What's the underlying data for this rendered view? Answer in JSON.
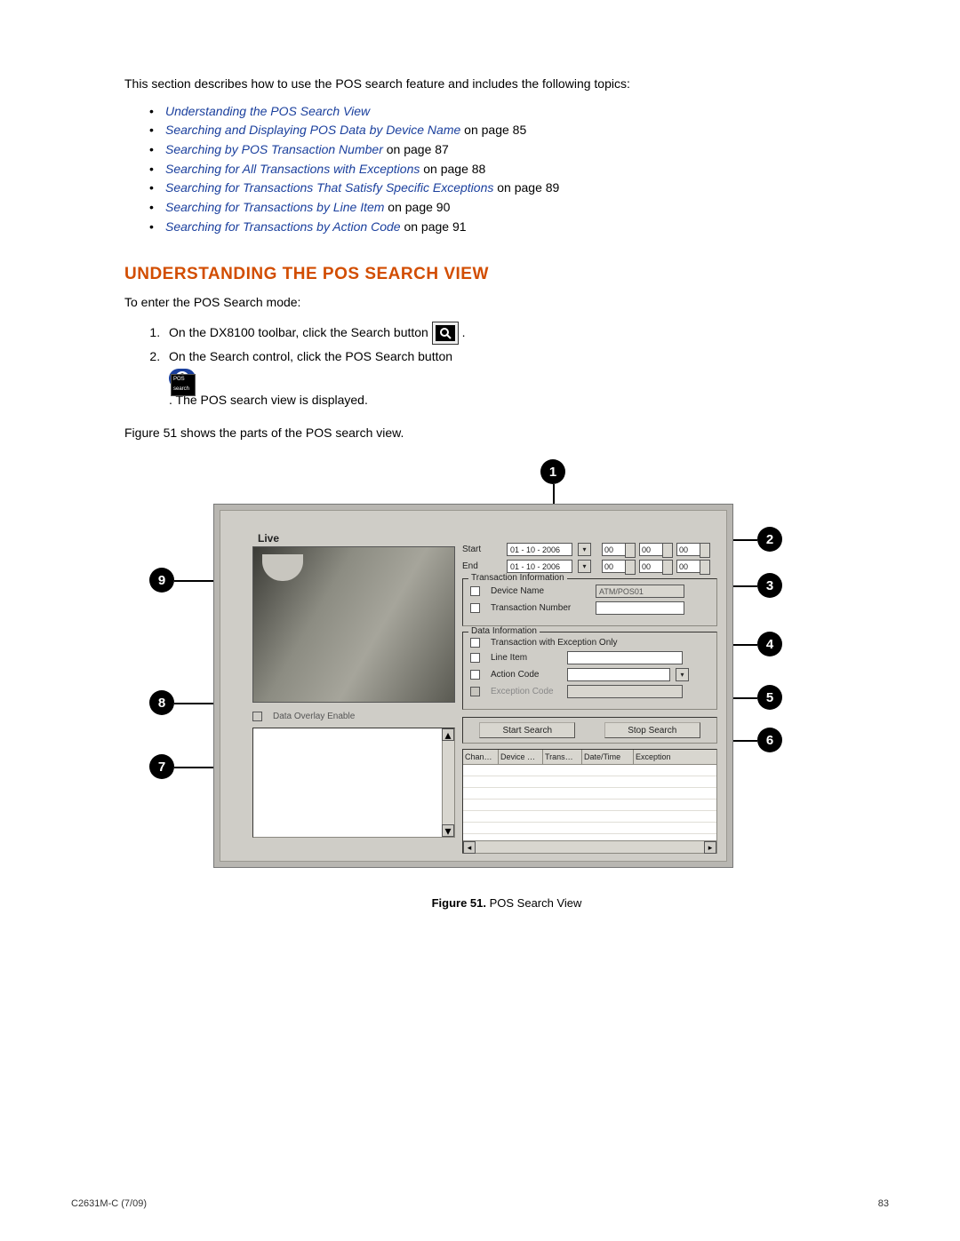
{
  "intro": "This section describes how to use the POS search feature and includes the following topics:",
  "bullets": [
    {
      "link": "Understanding the POS Search View",
      "suffix": ""
    },
    {
      "link": "Searching and Displaying POS Data by Device Name",
      "suffix": " on page 85"
    },
    {
      "link": "Searching by POS Transaction Number",
      "suffix": " on page 87"
    },
    {
      "link": "Searching for All Transactions with Exceptions",
      "suffix": " on page 88"
    },
    {
      "link": "Searching for Transactions That Satisfy Specific Exceptions",
      "suffix": " on page 89"
    },
    {
      "link": "Searching for Transactions by Line Item",
      "suffix": " on page 90"
    },
    {
      "link": "Searching for Transactions by Action Code",
      "suffix": " on page 91"
    }
  ],
  "section_heading": "UNDERSTANDING THE POS SEARCH VIEW",
  "enter_text": "To enter the POS Search mode:",
  "step1_a": "On the DX8100 toolbar, click the Search button",
  "step1_b": ".",
  "step2_a": "On the Search control, click the POS Search button",
  "step2_b": ". The POS search view is displayed.",
  "fig_intro": "Figure 51 shows the parts of the POS search view.",
  "figure": {
    "live": "Live",
    "start": "Start",
    "end": "End",
    "date1": "01 - 10 - 2006",
    "date2": "01 - 10 - 2006",
    "spin": "00",
    "ti_title": "Transaction Information",
    "device_name": "Device Name",
    "device_val": "ATM/POS01",
    "txn_num": "Transaction Number",
    "di_title": "Data Information",
    "txn_ex": "Transaction with Exception Only",
    "line_item": "Line Item",
    "action_code": "Action Code",
    "exception_code": "Exception Code",
    "start_search": "Start Search",
    "stop_search": "Stop Search",
    "cols": {
      "c1": "Chan…",
      "c2": "Device …",
      "c3": "Trans…",
      "c4": "Date/Time",
      "c5": "Exception"
    },
    "overlay": "Data Overlay Enable"
  },
  "callouts": [
    "1",
    "2",
    "3",
    "4",
    "5",
    "6",
    "7",
    "8",
    "9"
  ],
  "figcap_b": "Figure 51.",
  "figcap_t": "  POS Search View",
  "pos_pill": "$",
  "pos_sub": "POS search",
  "footer_left": "C2631M-C (7/09)",
  "footer_right": "83"
}
